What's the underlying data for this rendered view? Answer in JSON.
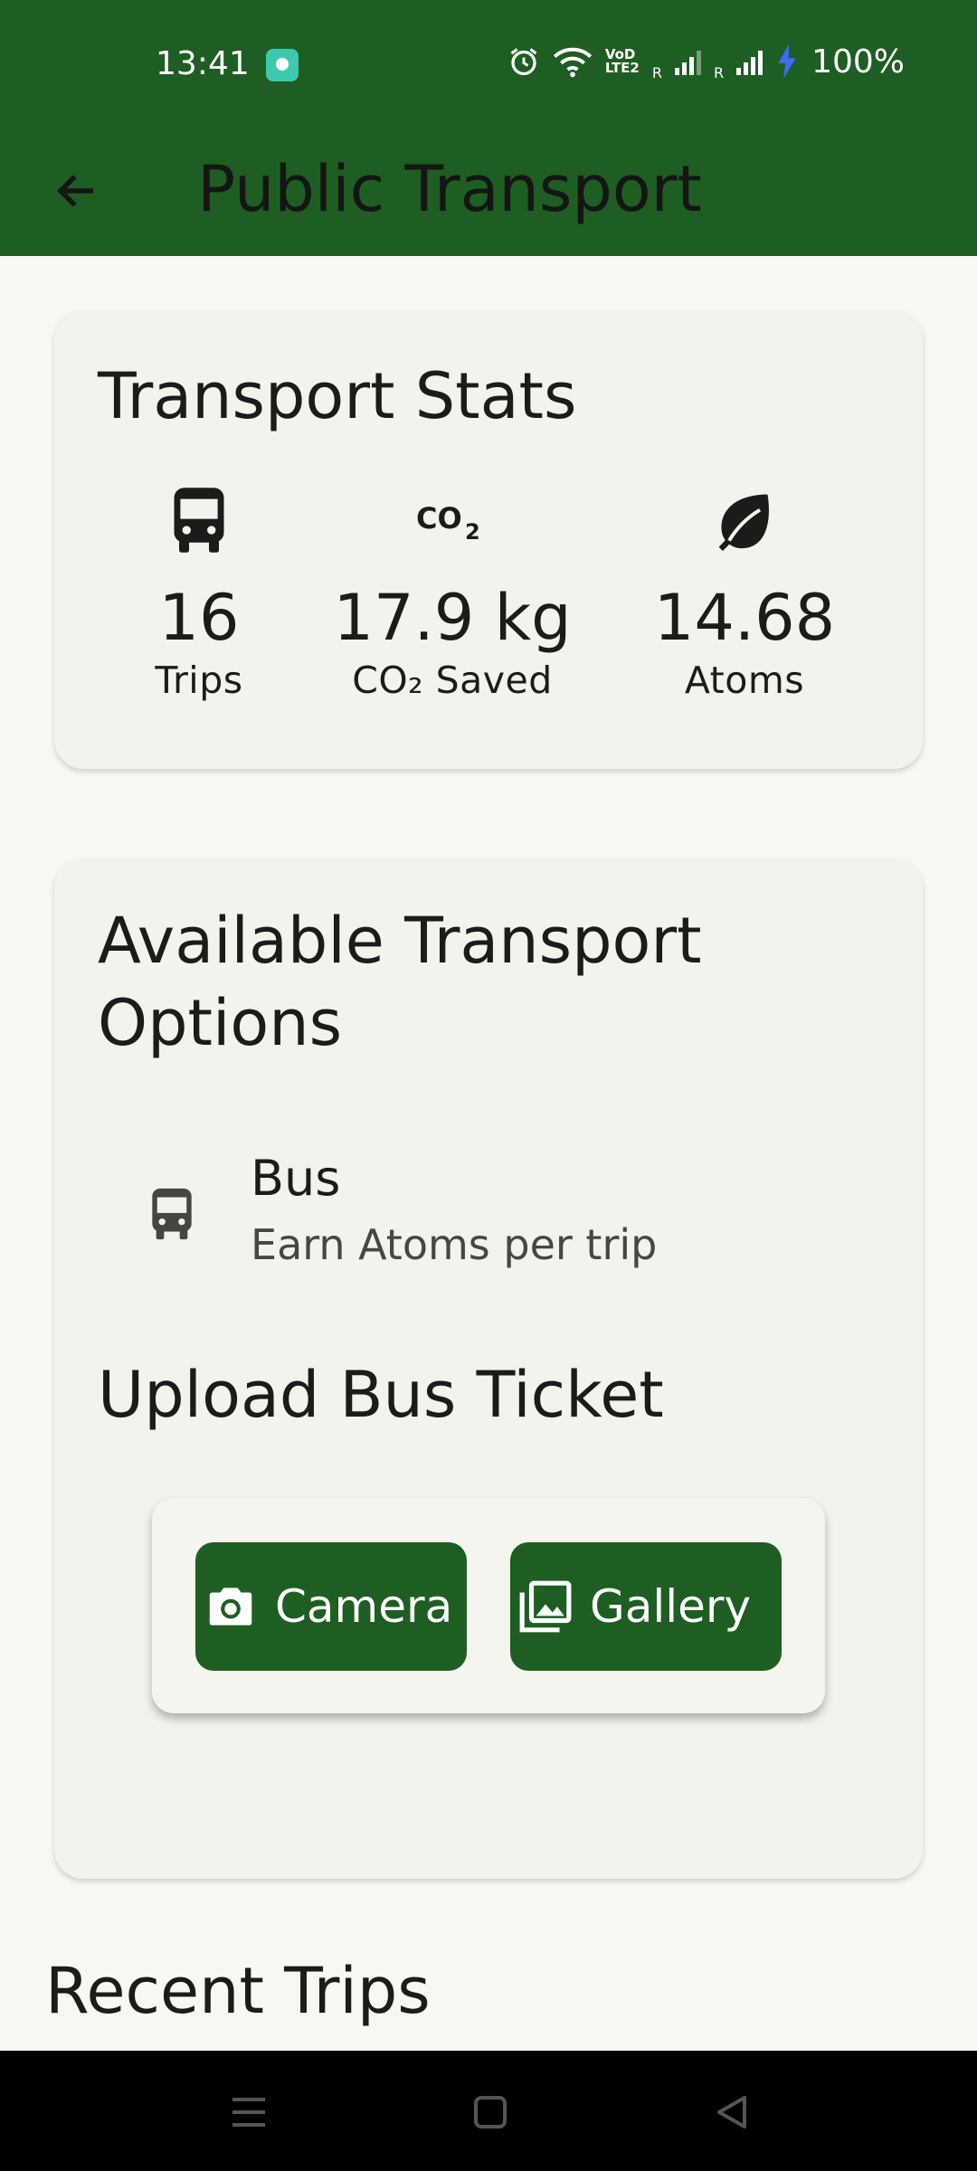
{
  "status_bar": {
    "time": "13:41",
    "battery": "100%",
    "network_label": "VoD\nLTE2",
    "signal_prefix": "R"
  },
  "app_bar": {
    "title": "Public Transport",
    "back_icon": "arrow-left-icon"
  },
  "stats_card": {
    "title": "Transport Stats",
    "items": [
      {
        "icon": "bus-icon",
        "value": "16",
        "label": "Trips"
      },
      {
        "icon": "co2-icon",
        "value": "17.9 kg",
        "label": "CO₂ Saved"
      },
      {
        "icon": "leaf-icon",
        "value": "14.68",
        "label": "Atoms"
      }
    ]
  },
  "options_card": {
    "title": "Available Transport Options",
    "options": [
      {
        "icon": "bus-icon",
        "name": "Bus",
        "subtitle": "Earn Atoms per trip"
      }
    ],
    "upload_title": "Upload Bus Ticket",
    "buttons": {
      "camera": "Camera",
      "gallery": "Gallery"
    }
  },
  "recent_title": "Recent Trips",
  "colors": {
    "primary": "#1e5e22",
    "background": "#f6f8f1",
    "card": "#f1f3ec"
  }
}
